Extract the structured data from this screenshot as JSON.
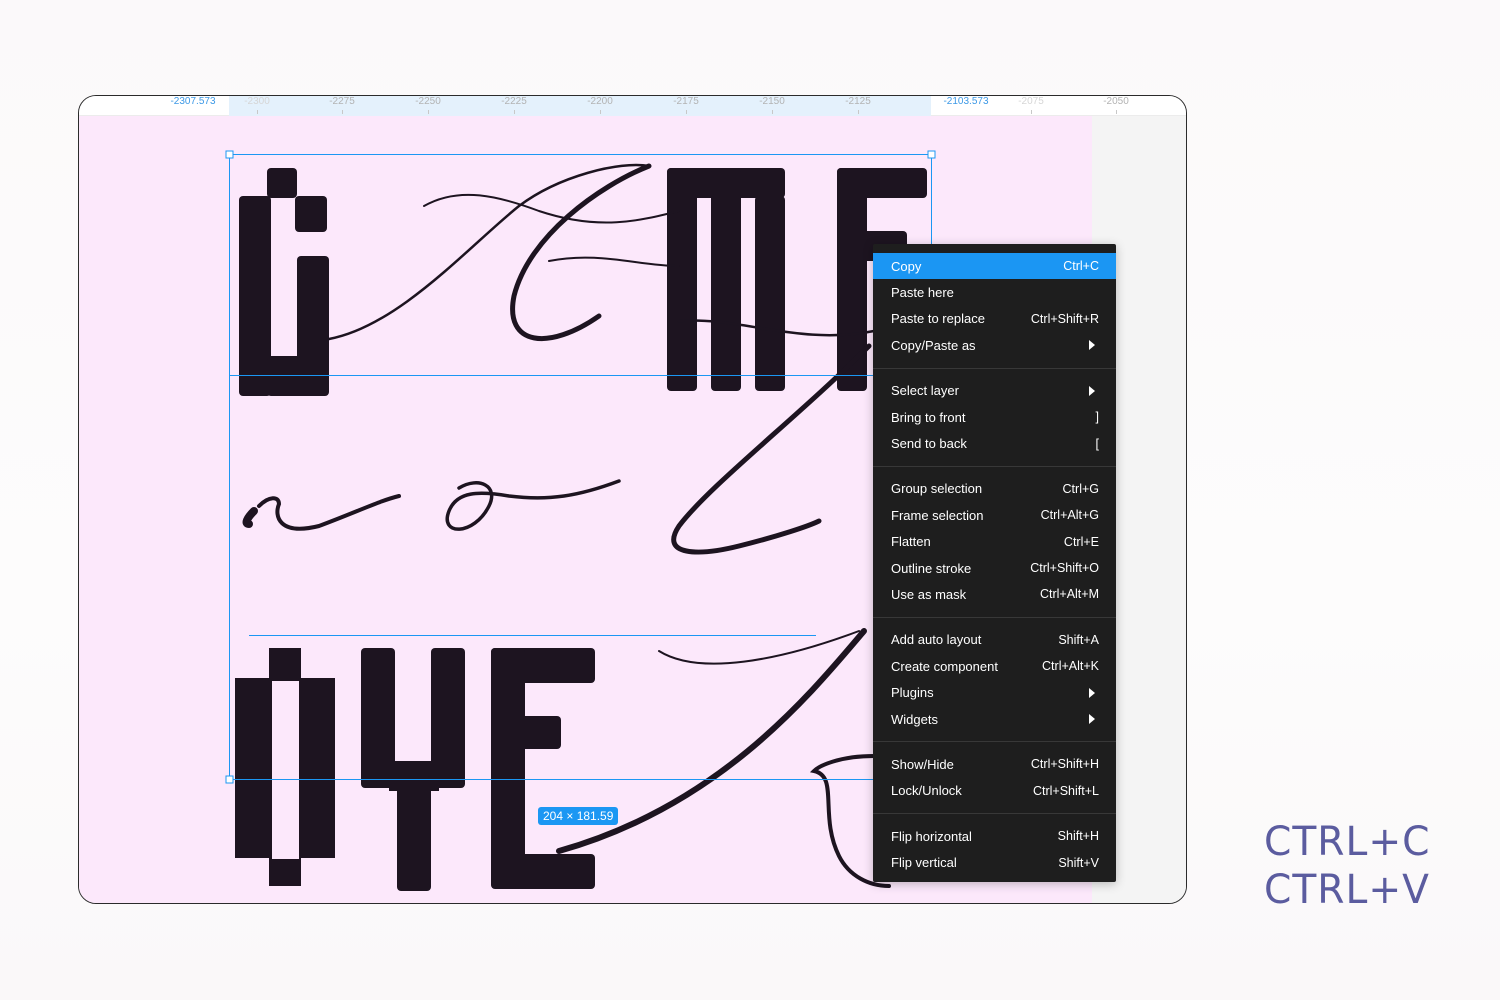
{
  "ruler": {
    "selection_start": "-2307.573",
    "selection_end": "-2103.573",
    "ticks": [
      "-2300",
      "-2275",
      "-2250",
      "-2225",
      "-2200",
      "-2175",
      "-2150",
      "-2125",
      "-2075",
      "-2050"
    ]
  },
  "canvas": {
    "background": "#fce8fb",
    "artwork_lines": [
      "GAME",
      "no l",
      "OYE A"
    ],
    "selection_size": "204 × 181.59",
    "selection_color": "#1b97f3"
  },
  "context_menu": {
    "groups": [
      [
        {
          "label": "Copy",
          "shortcut": "Ctrl+C",
          "active": true
        },
        {
          "label": "Paste here",
          "shortcut": ""
        },
        {
          "label": "Paste to replace",
          "shortcut": "Ctrl+Shift+R"
        },
        {
          "label": "Copy/Paste as",
          "submenu": true
        }
      ],
      [
        {
          "label": "Select layer",
          "submenu": true
        },
        {
          "label": "Bring to front",
          "shortcut": "]"
        },
        {
          "label": "Send to back",
          "shortcut": "["
        }
      ],
      [
        {
          "label": "Group selection",
          "shortcut": "Ctrl+G"
        },
        {
          "label": "Frame selection",
          "shortcut": "Ctrl+Alt+G"
        },
        {
          "label": "Flatten",
          "shortcut": "Ctrl+E"
        },
        {
          "label": "Outline stroke",
          "shortcut": "Ctrl+Shift+O"
        },
        {
          "label": "Use as mask",
          "shortcut": "Ctrl+Alt+M"
        }
      ],
      [
        {
          "label": "Add auto layout",
          "shortcut": "Shift+A"
        },
        {
          "label": "Create component",
          "shortcut": "Ctrl+Alt+K"
        },
        {
          "label": "Plugins",
          "submenu": true
        },
        {
          "label": "Widgets",
          "submenu": true
        }
      ],
      [
        {
          "label": "Show/Hide",
          "shortcut": "Ctrl+Shift+H"
        },
        {
          "label": "Lock/Unlock",
          "shortcut": "Ctrl+Shift+L"
        }
      ],
      [
        {
          "label": "Flip horizontal",
          "shortcut": "Shift+H"
        },
        {
          "label": "Flip vertical",
          "shortcut": "Shift+V"
        }
      ]
    ],
    "active_color": "#1b96f3"
  },
  "hotkeys": {
    "copy": "CTRL+C",
    "paste": "CTRL+V",
    "color": "#5b5c9f"
  }
}
